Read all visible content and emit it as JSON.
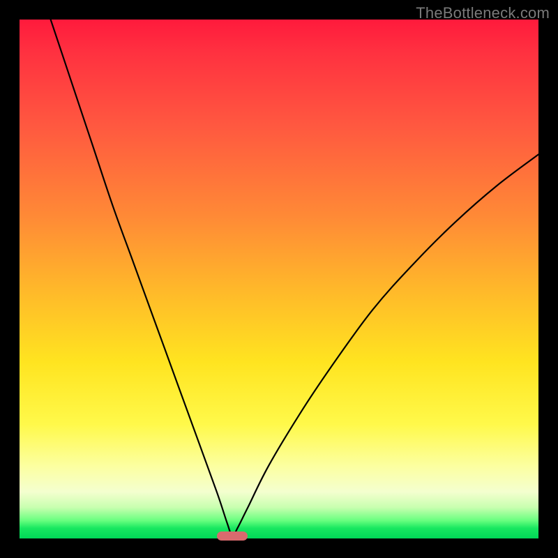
{
  "watermark": "TheBottleneck.com",
  "colors": {
    "frame": "#000000",
    "curve": "#000000",
    "marker": "#d96a6e",
    "gradient_stops": [
      "#ff1a3c",
      "#ff5740",
      "#ff8a36",
      "#ffb82a",
      "#ffe420",
      "#fff94a",
      "#f4ffcf",
      "#18e860"
    ]
  },
  "chart_data": {
    "type": "line",
    "title": "",
    "xlabel": "",
    "ylabel": "",
    "xlim": [
      0,
      100
    ],
    "ylim": [
      0,
      100
    ],
    "grid": false,
    "legend": false,
    "note": "No axis ticks or numeric labels are rendered; values estimated from pixel positions on a 0–100 normalized frame. V-shaped bottleneck curve with minimum at x≈41.",
    "series": [
      {
        "name": "bottleneck-curve",
        "x": [
          6,
          10,
          14,
          18,
          22,
          26,
          30,
          34,
          38,
          40,
          41,
          42,
          44,
          48,
          54,
          60,
          68,
          76,
          84,
          92,
          100
        ],
        "y": [
          100,
          88,
          76,
          64,
          53,
          42,
          31,
          20,
          9,
          3,
          0.5,
          2,
          6,
          14,
          24,
          33,
          44,
          53,
          61,
          68,
          74
        ]
      }
    ],
    "markers": [
      {
        "name": "optimal-range",
        "x_center": 41,
        "y": 0.5,
        "width_pct": 6
      }
    ]
  }
}
